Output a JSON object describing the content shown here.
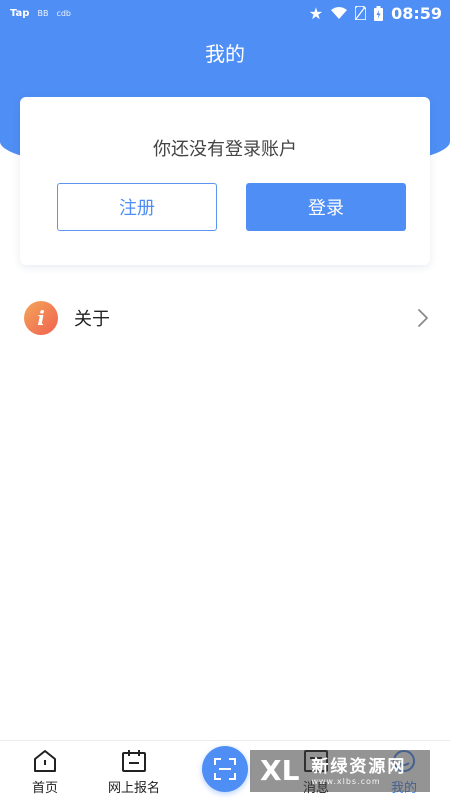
{
  "status_bar": {
    "left_items": [
      "Tap",
      "BB",
      "cdb"
    ],
    "time": "08:59"
  },
  "header": {
    "title": "我的"
  },
  "login_card": {
    "prompt": "你还没有登录账户",
    "register_label": "注册",
    "login_label": "登录"
  },
  "menu": {
    "items": [
      {
        "label": "关于",
        "icon": "info-icon",
        "icon_glyph": "i"
      }
    ]
  },
  "bottom_nav": {
    "items": [
      {
        "label": "首页",
        "icon": "home-icon"
      },
      {
        "label": "网上报名",
        "icon": "calendar-icon"
      },
      {
        "label": "",
        "icon": "scan-icon"
      },
      {
        "label": "消息",
        "icon": "message-icon"
      },
      {
        "label": "我的",
        "icon": "profile-icon",
        "active": true
      }
    ]
  },
  "watermark": {
    "logo": "XL",
    "text": "新绿资源网",
    "url": "www.xlbs.com"
  },
  "colors": {
    "primary": "#4f8ef4",
    "about_icon_start": "#f3a65a",
    "about_icon_end": "#f0604f"
  }
}
